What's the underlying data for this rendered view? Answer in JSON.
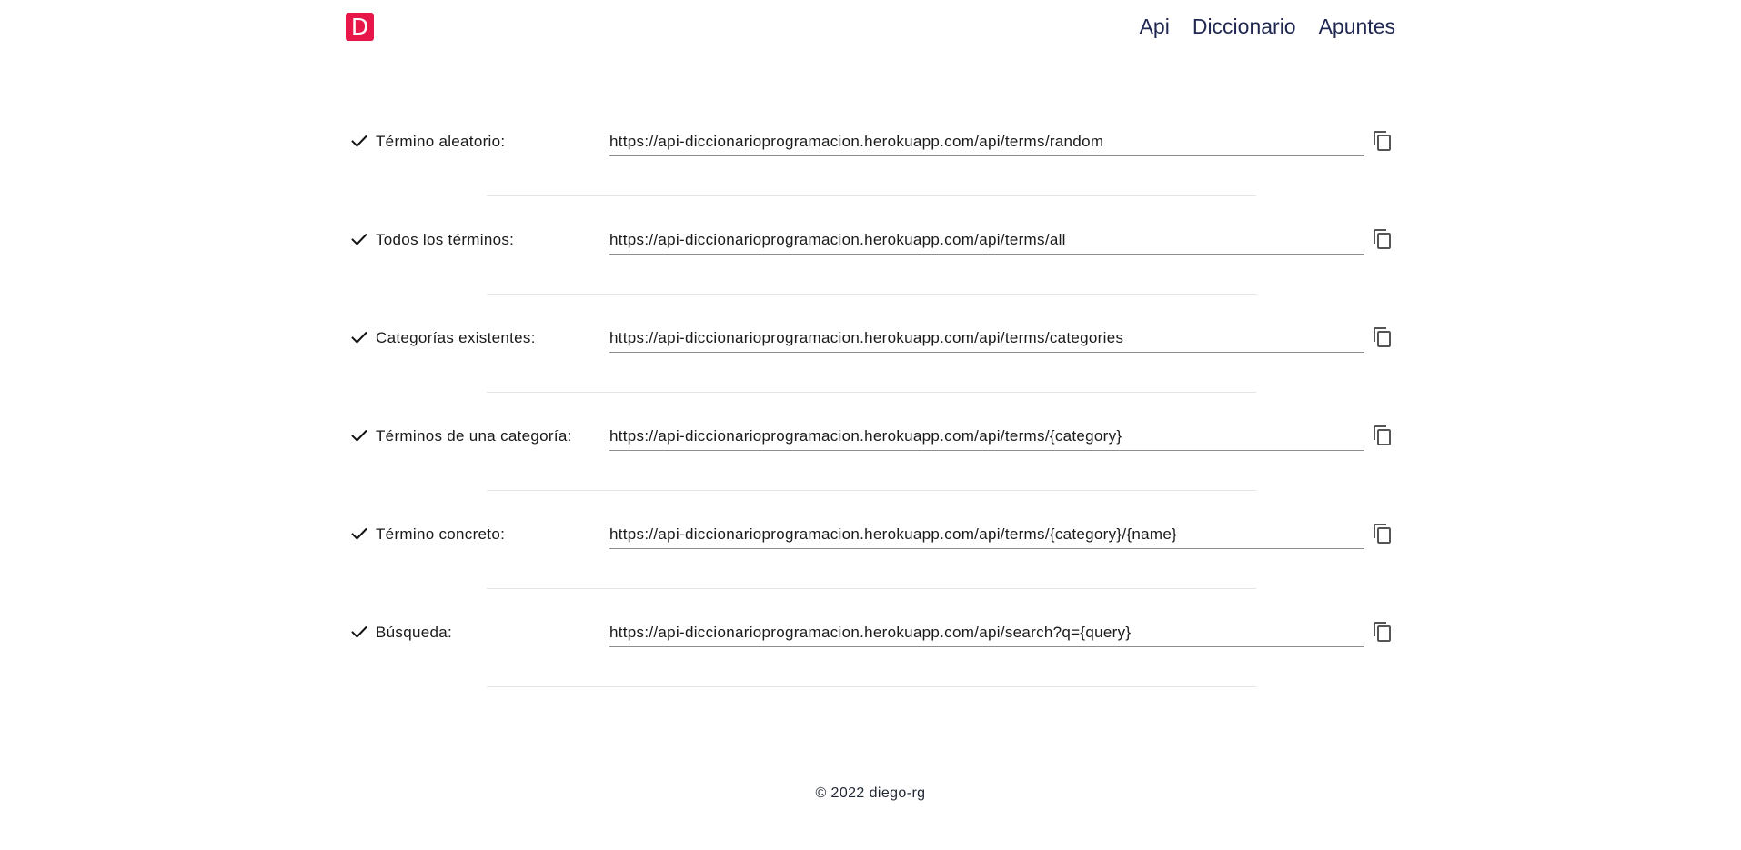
{
  "header": {
    "logo_letter": "D",
    "nav": [
      {
        "label": "Api"
      },
      {
        "label": "Diccionario"
      },
      {
        "label": "Apuntes"
      }
    ]
  },
  "endpoints": [
    {
      "label": "Término aleatorio:",
      "url": "https://api-diccionarioprogramacion.herokuapp.com/api/terms/random"
    },
    {
      "label": "Todos los términos:",
      "url": "https://api-diccionarioprogramacion.herokuapp.com/api/terms/all"
    },
    {
      "label": "Categorías existentes:",
      "url": "https://api-diccionarioprogramacion.herokuapp.com/api/terms/categories"
    },
    {
      "label": "Términos de una categoría:",
      "url": "https://api-diccionarioprogramacion.herokuapp.com/api/terms/{category}"
    },
    {
      "label": "Término concreto:",
      "url": "https://api-diccionarioprogramacion.herokuapp.com/api/terms/{category}/{name}"
    },
    {
      "label": "Búsqueda:",
      "url": "https://api-diccionarioprogramacion.herokuapp.com/api/search?q={query}"
    }
  ],
  "icons": {
    "row_marker": "check-icon",
    "copy": "copy-icon"
  },
  "footer": {
    "text": "© 2022 diego-rg"
  },
  "colors": {
    "brand": "#e8174a",
    "nav_text": "#1f2752",
    "divider": "#e4e4e4",
    "field_underline": "#8d8d8d"
  }
}
